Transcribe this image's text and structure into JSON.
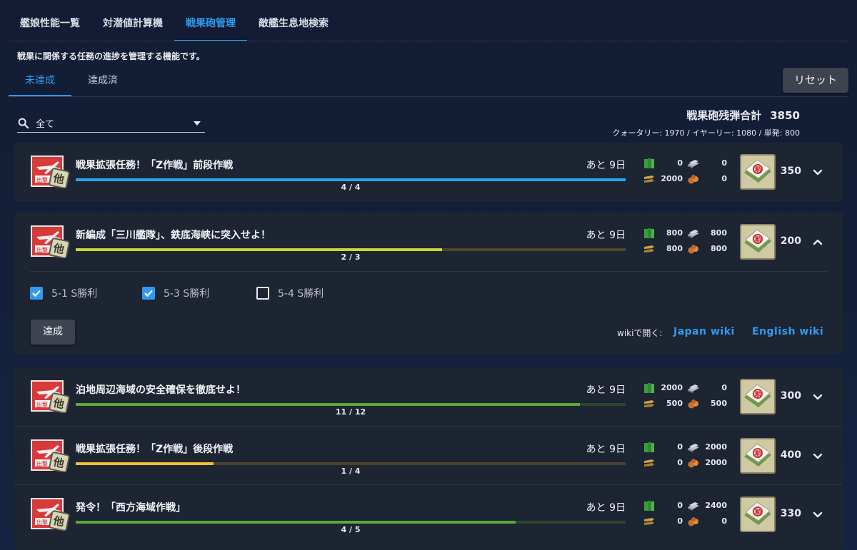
{
  "nav": {
    "tabs": [
      {
        "label": "艦娘性能一覧"
      },
      {
        "label": "対潜値計算機"
      },
      {
        "label": "戦果砲管理",
        "active": true
      },
      {
        "label": "敵艦生息地検索"
      }
    ]
  },
  "description": "戦果に関係する任務の進捗を管理する機能です。",
  "subtabs": [
    {
      "label": "未達成",
      "active": true
    },
    {
      "label": "達成済"
    }
  ],
  "reset_label": "リセット",
  "filter": {
    "value": "全て"
  },
  "summary": {
    "total_label": "戦果砲残弾合計",
    "total_value": "3850",
    "detail": "クォータリー: 1970  /  イヤーリー: 1080  /  単発: 800"
  },
  "colors": {
    "accent": "#2f9bf0",
    "blue": "#1ea7f5",
    "yellow": "#c7d93a",
    "green": "#5aaa3c",
    "gold": "#f2c12e"
  },
  "quests": [
    {
      "title": "戦果拡張任務！「Z作戦」前段作戦",
      "remain": "あと 9日",
      "progress_text": "4 / 4",
      "progress": 1.0,
      "bar_color": "#1ea7f5",
      "track_color": "#213a55",
      "fuel": "0",
      "steel": "0",
      "ammo": "2000",
      "baux": "0",
      "reward_count": "350",
      "expanded": false
    },
    {
      "title": "新編成「三川艦隊」、鉄底海峡に突入せよ！",
      "remain": "あと 9日",
      "progress_text": "2 / 3",
      "progress": 0.6667,
      "bar_color": "#c7d93a",
      "track_color": "#4a4a2c",
      "fuel": "800",
      "steel": "800",
      "ammo": "800",
      "baux": "800",
      "reward_count": "200",
      "expanded": true
    },
    {
      "title": "泊地周辺海域の安全確保を徹底せよ！",
      "remain": "あと 9日",
      "progress_text": "11 / 12",
      "progress": 0.9167,
      "bar_color": "#5aaa3c",
      "track_color": "#2c4630",
      "fuel": "2000",
      "steel": "0",
      "ammo": "500",
      "baux": "500",
      "reward_count": "300",
      "expanded": false
    },
    {
      "title": "戦果拡張任務！「Z作戦」後段作戦",
      "remain": "あと 9日",
      "progress_text": "1 / 4",
      "progress": 0.25,
      "bar_color": "#f2c12e",
      "track_color": "#4a422c",
      "fuel": "0",
      "steel": "2000",
      "ammo": "0",
      "baux": "2000",
      "reward_count": "400",
      "expanded": false
    },
    {
      "title": "発令！「西方海域作戦」",
      "remain": "あと 9日",
      "progress_text": "4 / 5",
      "progress": 0.8,
      "bar_color": "#5aaa3c",
      "track_color": "#2c4630",
      "fuel": "0",
      "steel": "2400",
      "ammo": "0",
      "baux": "0",
      "reward_count": "330",
      "expanded": false
    }
  ],
  "expanded_detail": {
    "checks": [
      {
        "label": "5-1 S勝利",
        "checked": true
      },
      {
        "label": "5-3 S勝利",
        "checked": true
      },
      {
        "label": "5-4 S勝利",
        "checked": false
      }
    ],
    "done_label": "達成",
    "wiki_label": "wikiで開く:",
    "japan_wiki": "Japan wiki",
    "english_wiki": "English wiki"
  },
  "icons": {
    "quest": "sortie-quest-icon",
    "reward": "medal-box-icon",
    "fuel": "fuel-icon",
    "steel": "steel-icon",
    "ammo": "ammo-icon",
    "baux": "bauxite-icon"
  }
}
